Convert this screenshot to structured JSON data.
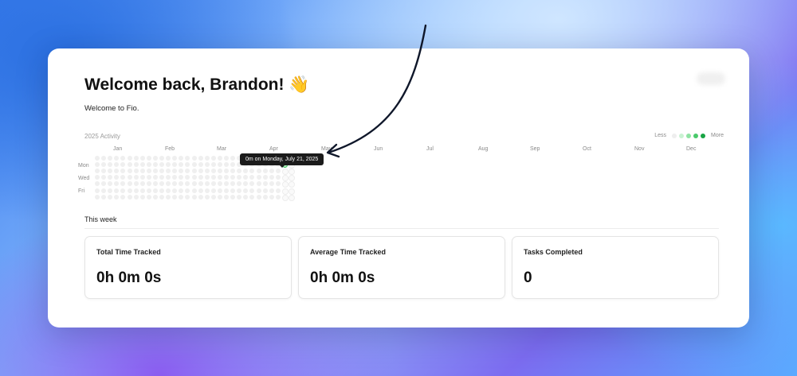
{
  "header": {
    "title": "Welcome back, Brandon! 👋",
    "subtitle": "Welcome to Fio."
  },
  "activity": {
    "title": "2025 Activity",
    "legend_less": "Less",
    "legend_more": "More",
    "legend_colors": [
      "#eeeeee",
      "#c9f2d2",
      "#8fe3a3",
      "#49c96b",
      "#18a444"
    ],
    "months": [
      "Jan",
      "Feb",
      "Mar",
      "Apr",
      "May",
      "Jun",
      "Jul",
      "Aug",
      "Sep",
      "Oct",
      "Nov",
      "Dec"
    ],
    "days": [
      "Mon",
      "Wed",
      "Fri"
    ],
    "tooltip": "0m on Monday, July 21, 2025",
    "highlighted_date": "2025-07-21"
  },
  "week": {
    "title": "This week",
    "stats": [
      {
        "label": "Total Time Tracked",
        "value": "0h 0m 0s"
      },
      {
        "label": "Average Time Tracked",
        "value": "0h 0m 0s"
      },
      {
        "label": "Tasks Completed",
        "value": "0"
      }
    ]
  },
  "colors": {
    "arrow": "#0f172a",
    "cell_empty": "#efefef",
    "cell_active": "#b9efc4"
  }
}
